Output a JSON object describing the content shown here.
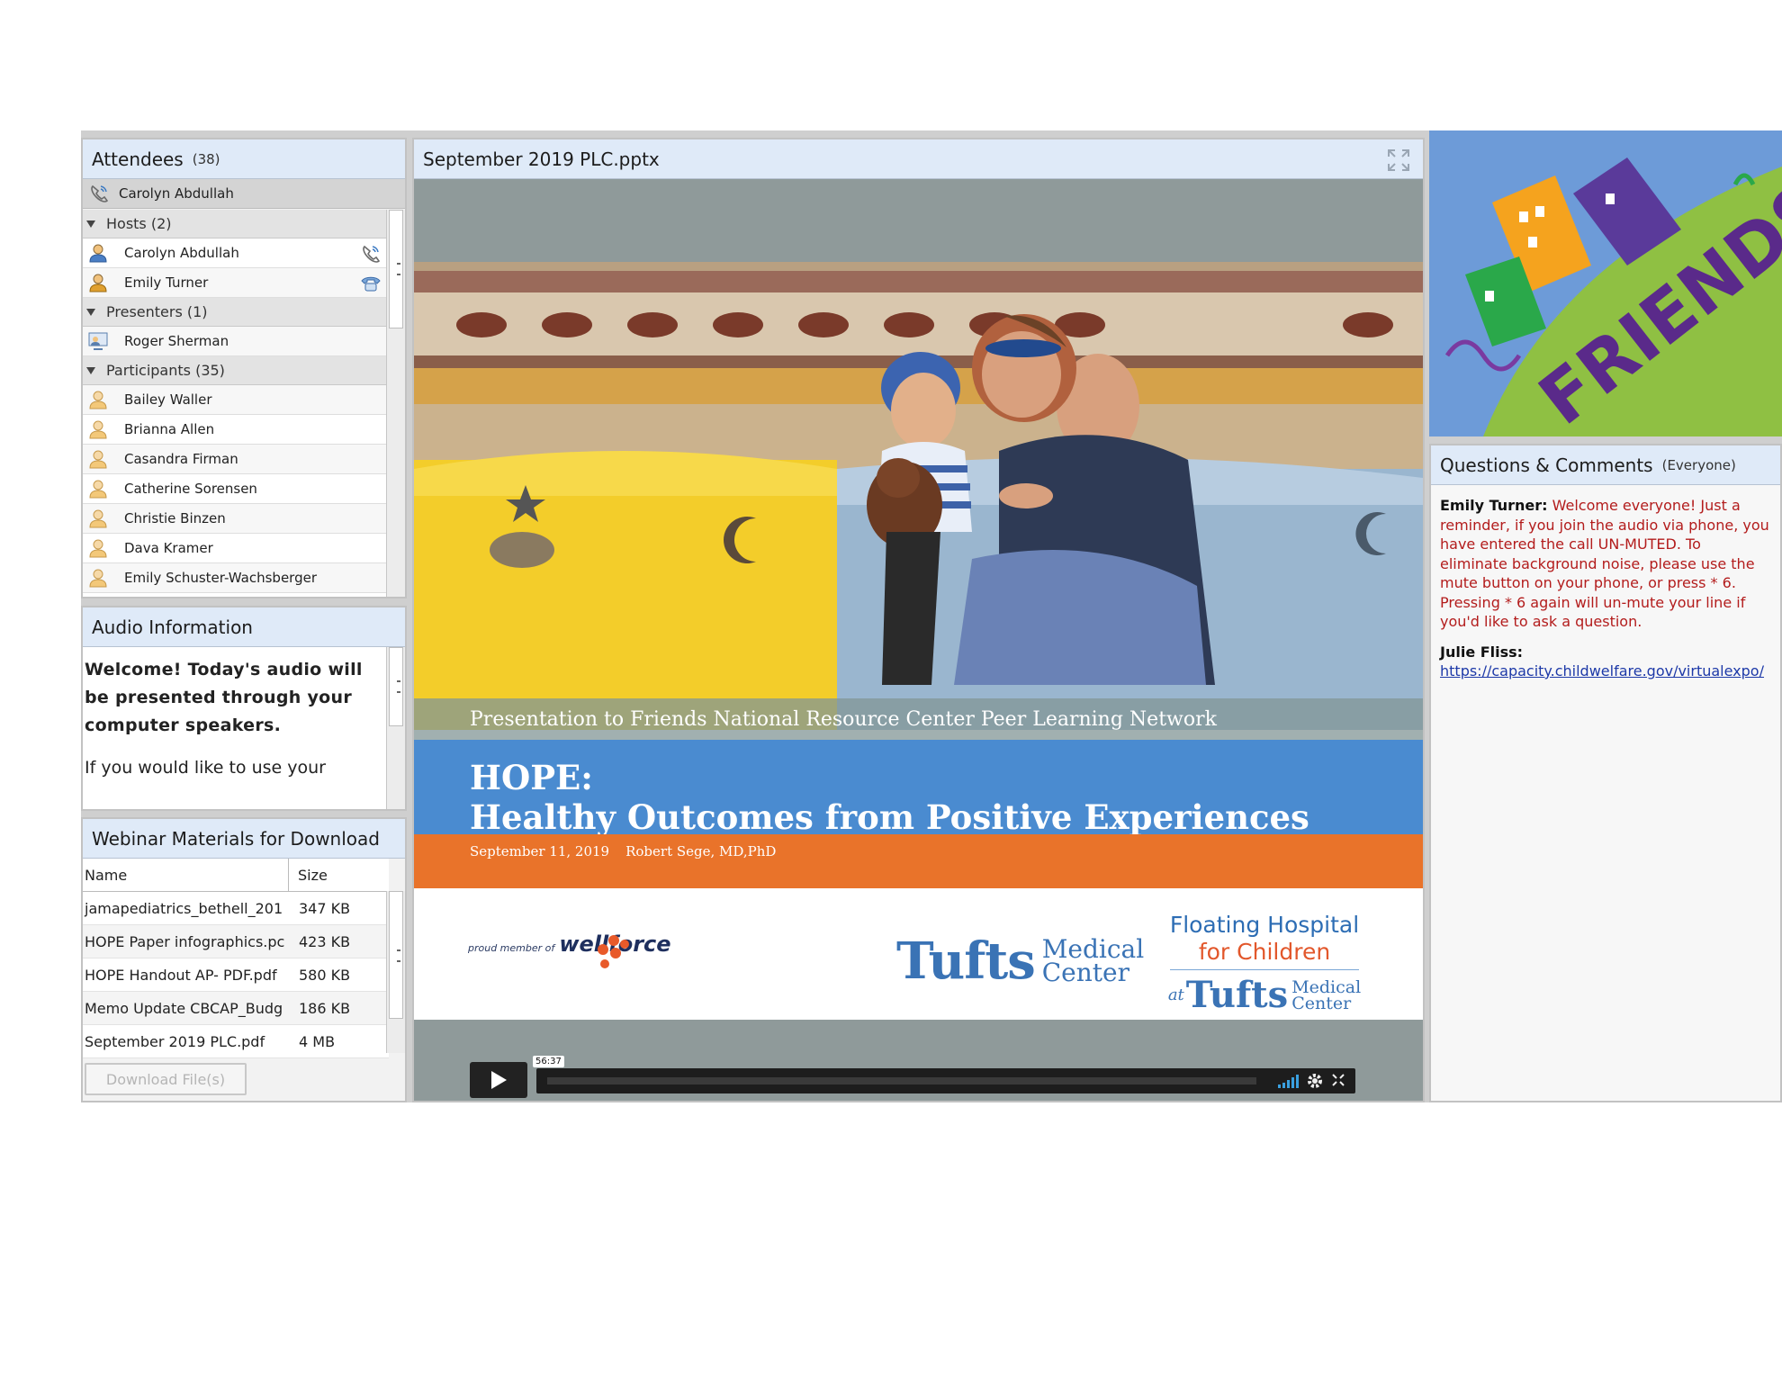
{
  "attendees": {
    "title": "Attendees",
    "count": "(38)",
    "current_user": "Carolyn Abdullah",
    "groups": [
      {
        "label": "Hosts (2)",
        "people": [
          {
            "name": "Carolyn Abdullah",
            "status_icon": "phone-icon"
          },
          {
            "name": "Emily Turner",
            "status_icon": "telephone-icon"
          }
        ]
      },
      {
        "label": "Presenters (1)",
        "people": [
          {
            "name": "Roger Sherman"
          }
        ]
      },
      {
        "label": "Participants (35)",
        "people": [
          {
            "name": "Bailey Waller"
          },
          {
            "name": "Brianna Allen"
          },
          {
            "name": "Casandra Firman"
          },
          {
            "name": "Catherine Sorensen"
          },
          {
            "name": "Christie Binzen"
          },
          {
            "name": "Dava Kramer"
          },
          {
            "name": "Emily Schuster-Wachsberger"
          }
        ]
      }
    ]
  },
  "audio": {
    "title": "Audio Information",
    "bold_text": "Welcome!  Today's audio will be presented through your computer speakers.",
    "text": "If you would like to use your"
  },
  "materials": {
    "title": "Webinar Materials for Download",
    "columns": [
      "Name",
      "Size"
    ],
    "rows": [
      {
        "name": "jamapediatrics_bethell_201",
        "size": "347 KB"
      },
      {
        "name": "HOPE Paper infographics.pc",
        "size": "423 KB"
      },
      {
        "name": "HOPE Handout AP- PDF.pdf",
        "size": "580 KB"
      },
      {
        "name": "Memo Update CBCAP_Budg",
        "size": "186 KB"
      },
      {
        "name": "September 2019 PLC.pdf",
        "size": "4 MB"
      }
    ],
    "download_label": "Download File(s)"
  },
  "share": {
    "title": "September 2019 PLC.pptx",
    "slide": {
      "caption": "Presentation to Friends National Resource Center Peer Learning Network",
      "title_line1": "HOPE:",
      "title_line2": "Healthy Outcomes from Positive Experiences",
      "date": "September 11, 2019",
      "presenter": "Robert Sege, MD,PhD",
      "wellforce_small": "proud member of",
      "wellforce_big": "wellforce",
      "tufts": "Tufts",
      "tufts_medical": "Medical",
      "tufts_center": "Center",
      "floating_1": "Floating Hospital",
      "floating_2": "for Children",
      "floating_at": "at"
    },
    "player": {
      "time": "56:37"
    }
  },
  "friends_logo_text": "FRIENDS",
  "qa": {
    "title": "Questions & Comments",
    "audience": "(Everyone)",
    "messages": [
      {
        "author": "Emily Turner:",
        "text": " Welcome everyone!  Just a reminder, if you join the audio via phone, you have entered the call UN-MUTED.  To eliminate background noise, please use the mute button on your phone, or press * 6.  Pressing * 6 again will un-mute your line if you'd like to ask a question."
      },
      {
        "author": "Julie Fliss:",
        "link": "https://capacity.childwelfare.gov/virtualexpo/"
      }
    ]
  },
  "colors": {
    "pod_header": "#dfeaf8",
    "slide_blue": "#4a8bd0",
    "slide_orange": "#e9732a",
    "chat_red": "#b31c1c",
    "link_blue": "#1d39a8"
  }
}
